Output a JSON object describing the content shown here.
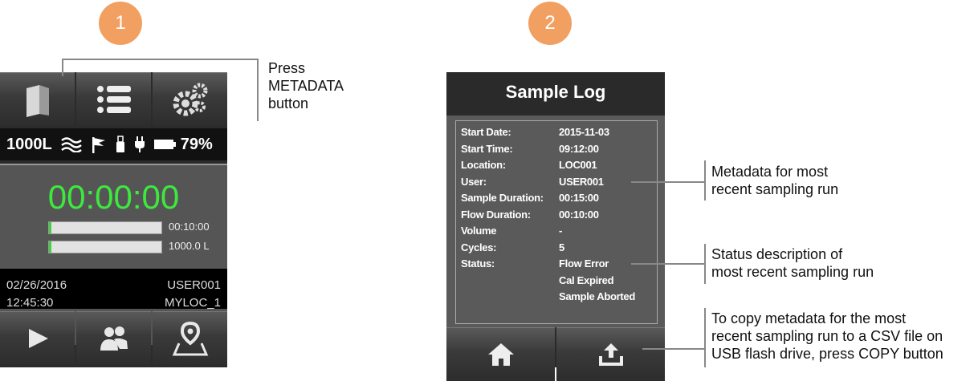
{
  "steps": {
    "one": "1",
    "two": "2"
  },
  "device1": {
    "toolbar": [
      {
        "name": "metadata-button",
        "icon": "book-icon"
      },
      {
        "name": "list-button",
        "icon": "list-icon"
      },
      {
        "name": "settings-button",
        "icon": "gears-icon"
      }
    ],
    "status": {
      "volume": "1000L",
      "battery": "79%"
    },
    "timer": "00:00:00",
    "progress": [
      {
        "label": "00:10:00",
        "fraction": 0.02
      },
      {
        "label": "1000.0 L",
        "fraction": 0.02
      }
    ],
    "info": {
      "date": "02/26/2016",
      "user": "USER001",
      "time": "12:45:30",
      "location": "MYLOC_1"
    },
    "colors": {
      "timer": "#3ee83e",
      "badge": "#f2a062"
    }
  },
  "callouts": {
    "press_metadata": [
      "Press",
      "METADATA",
      "button"
    ],
    "metadata": [
      "Metadata for most",
      "recent sampling run"
    ],
    "status": [
      "Status description of",
      "most recent sampling run"
    ],
    "copy": [
      "To copy metadata for the most",
      "recent sampling run to a CSV file on",
      "USB flash drive, press COPY button"
    ]
  },
  "device2": {
    "title": "Sample Log",
    "rows": [
      {
        "label": "Start Date:",
        "value": "2015-11-03"
      },
      {
        "label": "Start Time:",
        "value": "09:12:00"
      },
      {
        "label": "Location:",
        "value": "LOC001"
      },
      {
        "label": "User:",
        "value": "USER001"
      },
      {
        "label": "Sample Duration:",
        "value": "00:15:00"
      },
      {
        "label": "Flow Duration:",
        "value": "00:10:00"
      },
      {
        "label": "Volume",
        "value": "-"
      },
      {
        "label": "Cycles:",
        "value": "5"
      },
      {
        "label": "Status:",
        "value": "Flow Error"
      },
      {
        "label": "",
        "value": "Cal Expired"
      },
      {
        "label": "",
        "value": "Sample Aborted"
      }
    ]
  }
}
